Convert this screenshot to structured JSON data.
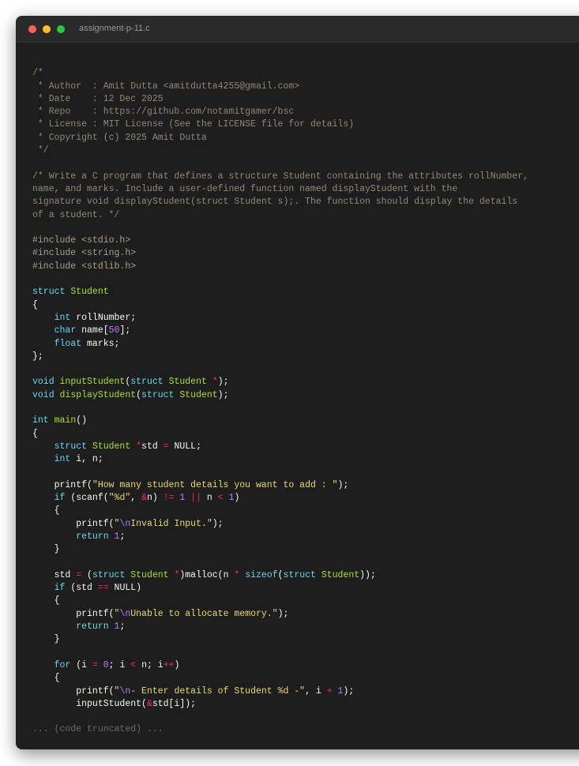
{
  "window": {
    "title": "assignment-p-11.c",
    "truncation_note": "... (code truncated) ..."
  },
  "colors": {
    "background": "#1e1e1e",
    "comment": "#8f8a78",
    "keyword": "#66d9ef",
    "type": "#a6e22e",
    "string": "#e6db74",
    "number": "#ae81ff",
    "operator": "#f92672"
  },
  "code": {
    "lines": [
      [],
      [
        [
          "cm",
          "/*"
        ]
      ],
      [
        [
          "cm",
          " * Author  : Amit Dutta <amitdutta4255@gmail.com>"
        ]
      ],
      [
        [
          "cm",
          " * Date    : 12 Dec 2025"
        ]
      ],
      [
        [
          "cm",
          " * Repo    : https://github.com/notamitgamer/bsc"
        ]
      ],
      [
        [
          "cm",
          " * License : MIT License (See the LICENSE file for details)"
        ]
      ],
      [
        [
          "cm",
          " * Copyright (c) 2025 Amit Dutta"
        ]
      ],
      [
        [
          "cm",
          " */"
        ]
      ],
      [],
      [
        [
          "cm",
          "/* Write a C program that defines a structure Student containing the attributes rollNumber,"
        ]
      ],
      [
        [
          "cm",
          "name, and marks. Include a user-defined function named displayStudent with the"
        ]
      ],
      [
        [
          "cm",
          "signature void displayStudent(struct Student s);. The function should display the details"
        ]
      ],
      [
        [
          "cm",
          "of a student. */"
        ]
      ],
      [],
      [
        [
          "pp",
          "#include <stdio.h>"
        ]
      ],
      [
        [
          "pp",
          "#include <string.h>"
        ]
      ],
      [
        [
          "pp",
          "#include <stdlib.h>"
        ]
      ],
      [],
      [
        [
          "kw",
          "struct "
        ],
        [
          "ty",
          "Student"
        ]
      ],
      [
        [
          "",
          "{"
        ]
      ],
      [
        [
          "",
          "    "
        ],
        [
          "kw",
          "int "
        ],
        [
          "",
          "rollNumber;"
        ]
      ],
      [
        [
          "",
          "    "
        ],
        [
          "kw",
          "char "
        ],
        [
          "",
          "name["
        ],
        [
          "nu",
          "50"
        ],
        [
          "",
          "];"
        ]
      ],
      [
        [
          "",
          "    "
        ],
        [
          "kw",
          "float "
        ],
        [
          "",
          "marks;"
        ]
      ],
      [
        [
          "",
          "};"
        ]
      ],
      [],
      [
        [
          "kw",
          "void "
        ],
        [
          "fn",
          "inputStudent"
        ],
        [
          "",
          "("
        ],
        [
          "kw",
          "struct "
        ],
        [
          "ty",
          "Student "
        ],
        [
          "op",
          "*"
        ],
        [
          "",
          ");"
        ]
      ],
      [
        [
          "kw",
          "void "
        ],
        [
          "fn",
          "displayStudent"
        ],
        [
          "",
          "("
        ],
        [
          "kw",
          "struct "
        ],
        [
          "ty",
          "Student"
        ],
        [
          "",
          ");"
        ]
      ],
      [],
      [
        [
          "kw",
          "int "
        ],
        [
          "fn",
          "main"
        ],
        [
          "",
          "()"
        ]
      ],
      [
        [
          "",
          "{"
        ]
      ],
      [
        [
          "",
          "    "
        ],
        [
          "kw",
          "struct "
        ],
        [
          "ty",
          "Student "
        ],
        [
          "op",
          "*"
        ],
        [
          "",
          "std "
        ],
        [
          "op",
          "="
        ],
        [
          "",
          " NULL;"
        ]
      ],
      [
        [
          "",
          "    "
        ],
        [
          "kw",
          "int "
        ],
        [
          "",
          "i, n;"
        ]
      ],
      [],
      [
        [
          "",
          "    printf("
        ],
        [
          "st",
          "\"How many student details you want to add : \""
        ],
        [
          "",
          ");"
        ]
      ],
      [
        [
          "",
          "    "
        ],
        [
          "kw",
          "if "
        ],
        [
          "",
          "(scanf("
        ],
        [
          "st",
          "\"%d\""
        ],
        [
          "",
          ", "
        ],
        [
          "op",
          "&"
        ],
        [
          "",
          "n) "
        ],
        [
          "op",
          "!="
        ],
        [
          " ",
          ""
        ],
        [
          "nu",
          "1"
        ],
        [
          " ",
          ""
        ],
        [
          "op",
          "||"
        ],
        [
          "",
          " n "
        ],
        [
          "op",
          "<"
        ],
        [
          " ",
          ""
        ],
        [
          "nu",
          "1"
        ],
        [
          "",
          ")"
        ]
      ],
      [
        [
          "",
          "    {"
        ]
      ],
      [
        [
          "",
          "        printf("
        ],
        [
          "st",
          "\""
        ],
        [
          "es",
          "\\n"
        ],
        [
          "st",
          "Invalid Input.\""
        ],
        [
          "",
          ");"
        ]
      ],
      [
        [
          "",
          "        "
        ],
        [
          "kw",
          "return "
        ],
        [
          "nu",
          "1"
        ],
        [
          "",
          ";"
        ]
      ],
      [
        [
          "",
          "    }"
        ]
      ],
      [],
      [
        [
          "",
          "    std "
        ],
        [
          "op",
          "="
        ],
        [
          "",
          " ("
        ],
        [
          "kw",
          "struct "
        ],
        [
          "ty",
          "Student "
        ],
        [
          "op",
          "*"
        ],
        [
          "",
          ")malloc(n "
        ],
        [
          "op",
          "*"
        ],
        [
          " ",
          ""
        ],
        [
          "kw",
          "sizeof"
        ],
        [
          "",
          "("
        ],
        [
          "kw",
          "struct "
        ],
        [
          "ty",
          "Student"
        ],
        [
          "",
          "));"
        ]
      ],
      [
        [
          "",
          "    "
        ],
        [
          "kw",
          "if "
        ],
        [
          "",
          "(std "
        ],
        [
          "op",
          "=="
        ],
        [
          "",
          " NULL)"
        ]
      ],
      [
        [
          "",
          "    {"
        ]
      ],
      [
        [
          "",
          "        printf("
        ],
        [
          "st",
          "\""
        ],
        [
          "es",
          "\\n"
        ],
        [
          "st",
          "Unable to allocate memory.\""
        ],
        [
          "",
          ");"
        ]
      ],
      [
        [
          "",
          "        "
        ],
        [
          "kw",
          "return "
        ],
        [
          "nu",
          "1"
        ],
        [
          "",
          ";"
        ]
      ],
      [
        [
          "",
          "    }"
        ]
      ],
      [],
      [
        [
          "",
          "    "
        ],
        [
          "kw",
          "for "
        ],
        [
          "",
          "(i "
        ],
        [
          "op",
          "="
        ],
        [
          " ",
          ""
        ],
        [
          "nu",
          "0"
        ],
        [
          "",
          "; i "
        ],
        [
          "op",
          "<"
        ],
        [
          "",
          " n; i"
        ],
        [
          "op",
          "++"
        ],
        [
          "",
          ")"
        ]
      ],
      [
        [
          "",
          "    {"
        ]
      ],
      [
        [
          "",
          "        printf("
        ],
        [
          "st",
          "\""
        ],
        [
          "es",
          "\\n"
        ],
        [
          "st",
          "- Enter details of Student %d -\""
        ],
        [
          "",
          ", i "
        ],
        [
          "op",
          "+"
        ],
        [
          " ",
          ""
        ],
        [
          "nu",
          "1"
        ],
        [
          "",
          ");"
        ]
      ],
      [
        [
          "",
          "        inputStudent("
        ],
        [
          "op",
          "&"
        ],
        [
          "",
          "std[i]);"
        ]
      ],
      []
    ]
  }
}
